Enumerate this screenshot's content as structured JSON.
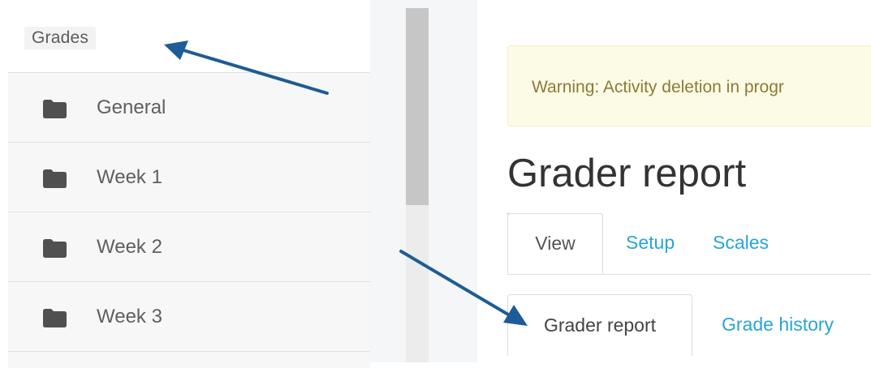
{
  "sidebar": {
    "grades_label": "Grades",
    "items": [
      {
        "label": "General",
        "icon": "folder-icon"
      },
      {
        "label": "Week 1",
        "icon": "folder-icon"
      },
      {
        "label": "Week 2",
        "icon": "folder-icon"
      },
      {
        "label": "Week 3",
        "icon": "folder-icon"
      }
    ]
  },
  "main": {
    "warning_text": "Warning: Activity deletion in progr",
    "page_title": "Grader report",
    "tabs": [
      "View",
      "Setup",
      "Scales"
    ],
    "subtabs": [
      "Grader report",
      "Grade history"
    ]
  },
  "colors": {
    "link": "#27a5d7",
    "arrow": "#1d5c96",
    "warning_bg": "#fcfbe6"
  }
}
